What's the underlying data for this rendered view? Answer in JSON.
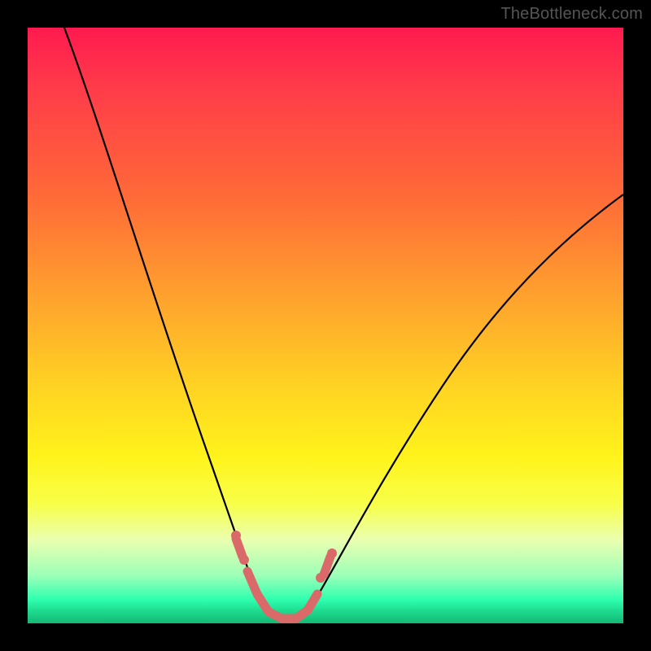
{
  "watermark": "TheBottleneck.com",
  "chart_data": {
    "type": "line",
    "title": "",
    "xlabel": "",
    "ylabel": "",
    "xlim": [
      0,
      100
    ],
    "ylim": [
      0,
      100
    ],
    "grid": false,
    "legend": false,
    "background_gradient": {
      "direction": "vertical",
      "stops": [
        {
          "pos": 0,
          "color": "#ff1a4f"
        },
        {
          "pos": 28,
          "color": "#ff6938"
        },
        {
          "pos": 60,
          "color": "#ffd223"
        },
        {
          "pos": 80,
          "color": "#f8ff49"
        },
        {
          "pos": 96,
          "color": "#2fffaf"
        },
        {
          "pos": 100,
          "color": "#14b874"
        }
      ]
    },
    "series": [
      {
        "name": "left-branch",
        "x": [
          6,
          10,
          14,
          18,
          22,
          26,
          29,
          32,
          34.5,
          36.5,
          38,
          39.5
        ],
        "y": [
          100,
          91,
          80,
          68,
          55,
          41,
          30,
          21,
          14,
          9,
          5,
          2
        ]
      },
      {
        "name": "valley",
        "x": [
          39.5,
          41,
          43,
          45,
          47
        ],
        "y": [
          2,
          1,
          0.5,
          1,
          2
        ]
      },
      {
        "name": "right-branch",
        "x": [
          47,
          50,
          55,
          62,
          70,
          80,
          90,
          100
        ],
        "y": [
          2,
          6,
          13,
          24,
          36,
          49,
          61,
          72
        ]
      }
    ],
    "markers": {
      "name": "highlight-band",
      "color": "#da6a6a",
      "points": [
        {
          "x": 34.5,
          "y": 15
        },
        {
          "x": 36,
          "y": 11
        },
        {
          "x": 37,
          "y": 8
        },
        {
          "x": 38.5,
          "y": 5
        },
        {
          "x": 40.5,
          "y": 2.5
        },
        {
          "x": 43,
          "y": 1.5
        },
        {
          "x": 45.5,
          "y": 2.5
        },
        {
          "x": 47.5,
          "y": 5
        },
        {
          "x": 49,
          "y": 8
        },
        {
          "x": 50.5,
          "y": 11
        }
      ]
    }
  }
}
